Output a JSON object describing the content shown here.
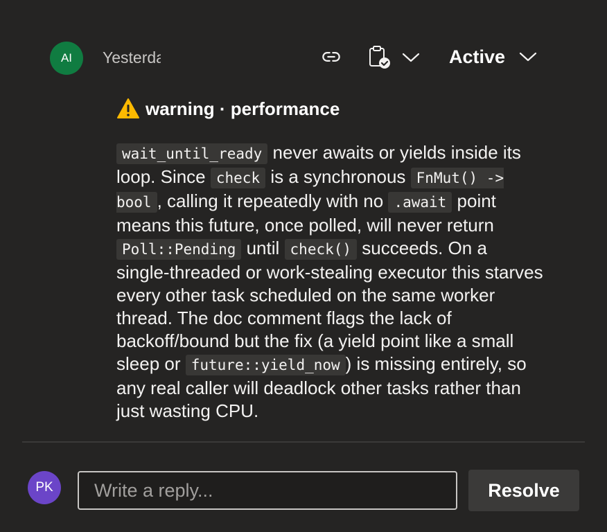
{
  "comment": {
    "author_initials": "AI",
    "author_name": "AI",
    "timestamp": "Yesterday",
    "status": "Active",
    "icons": {
      "copy_link": "link-icon",
      "clipboard": "clipboard-check-icon",
      "clipboard_menu": "chevron-down-icon",
      "status_menu": "chevron-down-icon",
      "severity": "warning-icon"
    },
    "heading": "warning · performance",
    "body": {
      "code_wait_until_ready": "wait_until_ready",
      "t1": " never awaits or yields inside its loop. Since ",
      "code_check": "check",
      "t2": " is a synchronous ",
      "code_fnmut": "FnMut() -> bool",
      "t3": ", calling it repeatedly with no ",
      "code_await": ".await",
      "t4": " point means this future, once polled, will never return ",
      "code_poll_pending": "Poll::Pending",
      "t5": " until ",
      "code_check_call": "check()",
      "t6": " succeeds. On a single-threaded or work-stealing executor this starves every other task scheduled on the same worker thread. The doc comment flags the lack of backoff/bound but the fix (a yield point like a small sleep or ",
      "code_yield_now": "future::yield_now",
      "t7": ") is missing entirely, so any real caller will deadlock other tasks rather than just wasting CPU."
    }
  },
  "reply": {
    "avatar_initials": "PK",
    "placeholder": "Write a reply...",
    "resolve_label": "Resolve"
  },
  "colors": {
    "background": "#252423",
    "ai_avatar": "#107c41",
    "pk_avatar": "#6b45c8",
    "code_background": "#383735",
    "resolve_button": "#3b3a39"
  }
}
